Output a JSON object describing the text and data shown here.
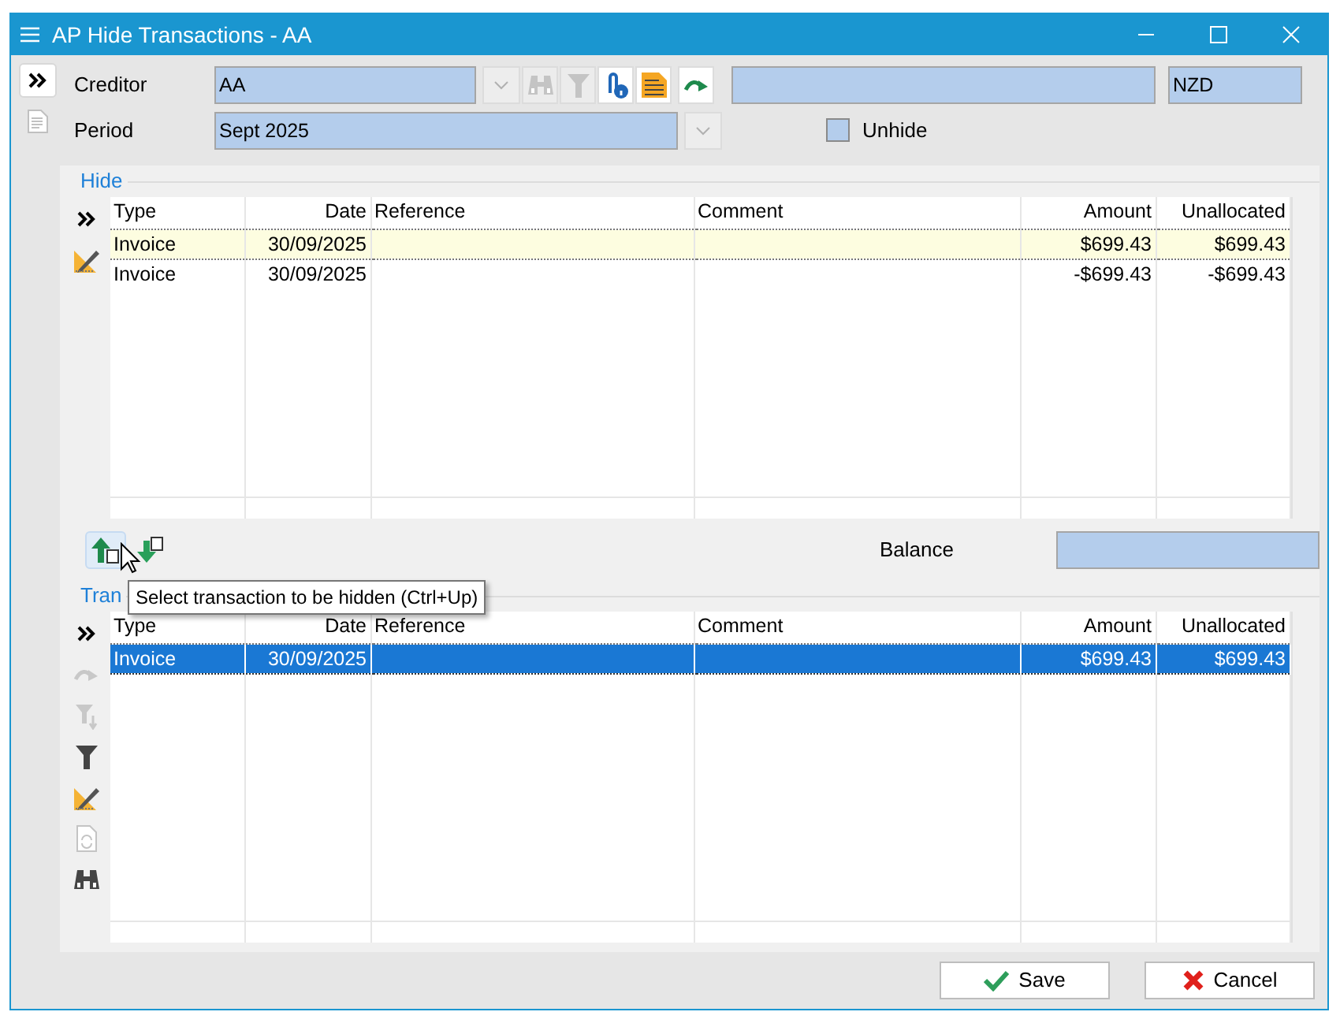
{
  "window": {
    "title": "AP Hide Transactions - AA"
  },
  "header": {
    "creditor": {
      "label": "Creditor",
      "value": "AA"
    },
    "currency": {
      "value": "NZD"
    },
    "period": {
      "label": "Period",
      "value": "Sept 2025"
    },
    "unhide": {
      "label": "Unhide",
      "checked": false
    }
  },
  "hide_group": {
    "title": "Hide",
    "has_focus": false,
    "columns": [
      "Type",
      "Date",
      "Reference",
      "Comment",
      "Amount",
      "Unallocated"
    ],
    "rows": [
      {
        "type": "Invoice",
        "date": "30/09/2025",
        "amount": "$699.43",
        "unallocated": "$699.43",
        "selected": true
      },
      {
        "type": "Invoice",
        "date": "30/09/2025",
        "amount": "-$699.43",
        "unallocated": "-$699.43",
        "selected": false
      }
    ]
  },
  "balance": {
    "label": "Balance"
  },
  "tooltip": {
    "text": "Select transaction to be hidden (Ctrl+Up)"
  },
  "transactions_group": {
    "title": "Tran",
    "has_focus": true,
    "columns": [
      "Type",
      "Date",
      "Reference",
      "Comment",
      "Amount",
      "Unallocated"
    ],
    "rows": [
      {
        "type": "Invoice",
        "date": "30/09/2025",
        "amount": "$699.43",
        "unallocated": "$699.43",
        "selected": true
      }
    ]
  },
  "buttons": [
    {
      "label": "Save",
      "kind": "save"
    },
    {
      "label": "Cancel",
      "kind": "cancel"
    }
  ]
}
